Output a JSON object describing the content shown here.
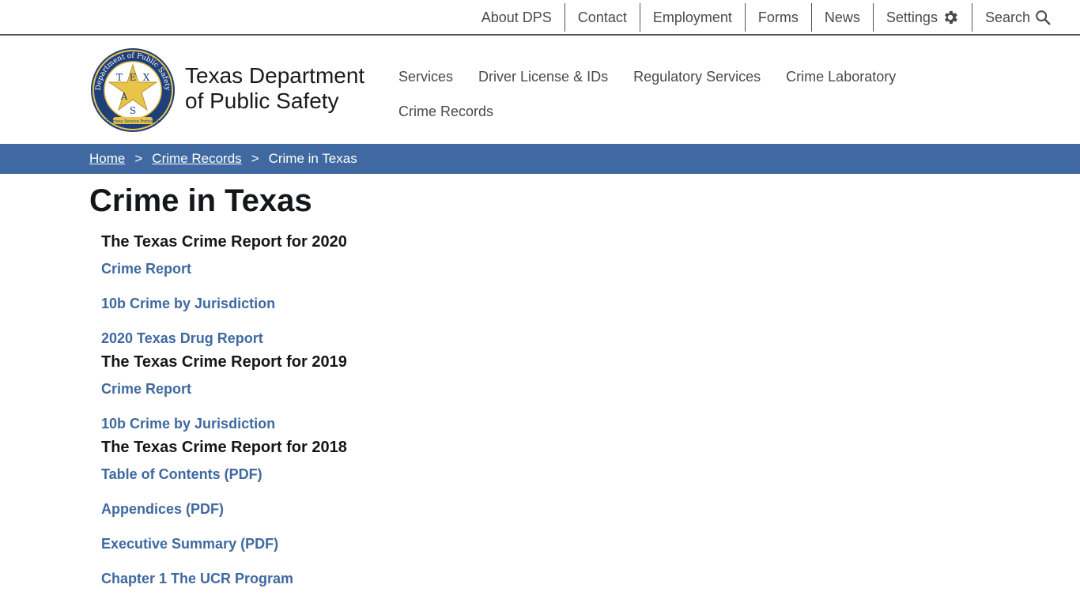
{
  "utility_nav": [
    {
      "label": "About DPS"
    },
    {
      "label": "Contact"
    },
    {
      "label": "Employment"
    },
    {
      "label": "Forms"
    },
    {
      "label": "News"
    },
    {
      "label": "Settings",
      "icon": "gear-icon"
    },
    {
      "label": "Search",
      "icon": "search-icon"
    }
  ],
  "header": {
    "site_name_line1": "Texas Department",
    "site_name_line2": "of Public Safety",
    "seal": {
      "ring_text": "Department of Public Safety",
      "letters": [
        "T",
        "E",
        "X",
        "A",
        "S"
      ],
      "motto": "Courtesy Service Protection"
    }
  },
  "main_nav": [
    {
      "label": "Services"
    },
    {
      "label": "Driver License & IDs"
    },
    {
      "label": "Regulatory Services"
    },
    {
      "label": "Crime Laboratory"
    },
    {
      "label": "Crime Records"
    }
  ],
  "breadcrumb": {
    "home": "Home",
    "sep1": ">",
    "parent": "Crime Records",
    "sep2": ">",
    "current": "Crime in Texas"
  },
  "page_title": "Crime in Texas",
  "sections": [
    {
      "heading": "The Texas Crime Report for 2020",
      "links": [
        "Crime Report",
        "10b Crime by Jurisdiction",
        "2020 Texas Drug Report"
      ]
    },
    {
      "heading": "The Texas Crime Report for 2019",
      "links": [
        "Crime Report",
        "10b Crime by Jurisdiction"
      ]
    },
    {
      "heading": "The Texas Crime Report for 2018",
      "links": [
        "Table of Contents (PDF)",
        "Appendices (PDF)",
        "Executive Summary (PDF)",
        "Chapter 1 The UCR Program"
      ]
    }
  ],
  "colors": {
    "brand_blue": "#3f69a0",
    "seal_navy": "#1f3f7a",
    "seal_gold": "#e8c44a"
  }
}
